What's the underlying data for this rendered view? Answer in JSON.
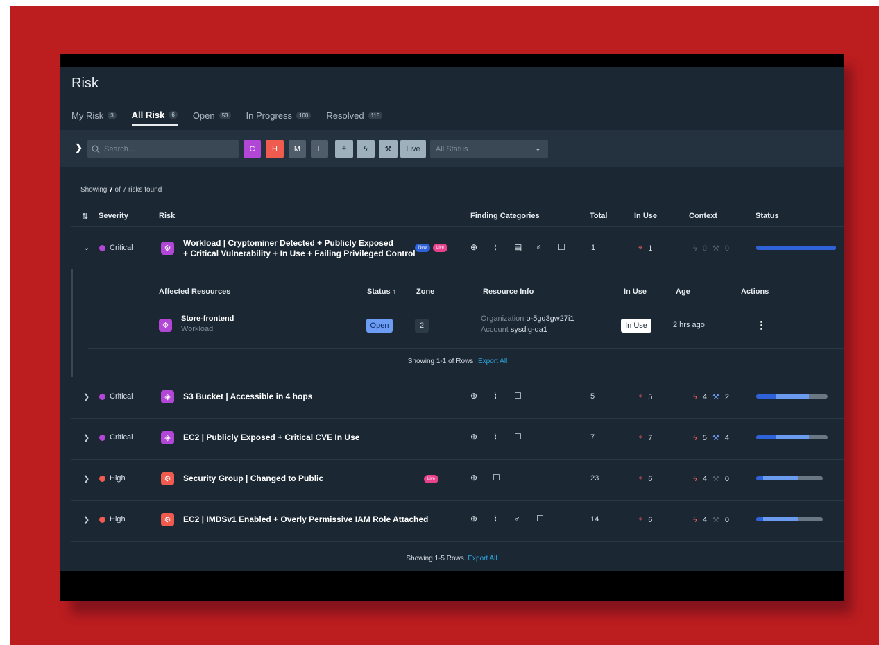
{
  "page": {
    "title": "Risk"
  },
  "tabs": [
    {
      "label": "My Risk",
      "count": "3"
    },
    {
      "label": "All Risk",
      "count": "6"
    },
    {
      "label": "Open",
      "count": "53"
    },
    {
      "label": "In Progress",
      "count": "100"
    },
    {
      "label": "Resolved",
      "count": "115"
    }
  ],
  "toolbar": {
    "search_placeholder": "Search...",
    "severity_chips": [
      "C",
      "H",
      "M",
      "L"
    ],
    "live_label": "Live",
    "status_select": "All Status"
  },
  "summary": {
    "prefix": "Showing",
    "shown": "7",
    "suffix": "of 7 risks found"
  },
  "columns": {
    "severity": "Severity",
    "risk": "Risk",
    "finding_categories": "Finding Categories",
    "total": "Total",
    "in_use": "In Use",
    "context": "Context",
    "status": "Status"
  },
  "rows": [
    {
      "severity": "Critical",
      "color": "#b246d6",
      "name_line1": "Workload | Cryptominer Detected + Publicly Exposed",
      "name_line2": "+ Critical Vulnerability + In Use + Failing Privileged Control",
      "badges": [
        "New",
        "Live"
      ],
      "categories": [
        "globe-icon",
        "bug-icon",
        "checklist-icon",
        "user-icon",
        "chat-icon"
      ],
      "total": "1",
      "in_use": "1",
      "context_events": "0",
      "context_fixes": "0",
      "progress": 1.0
    },
    {
      "severity": "Critical",
      "color": "#b246d6",
      "name_line1": "S3 Bucket | Accessible in 4 hops",
      "badges": [],
      "categories": [
        "globe-icon",
        "bug-icon",
        "chat-icon"
      ],
      "total": "5",
      "in_use": "5",
      "context_events": "4",
      "context_fixes": "2",
      "progress": 0.74
    },
    {
      "severity": "Critical",
      "color": "#b246d6",
      "name_line1": "EC2 | Publicly Exposed + Critical CVE In Use",
      "badges": [],
      "categories": [
        "globe-icon",
        "bug-icon",
        "chat-icon"
      ],
      "total": "7",
      "in_use": "7",
      "context_events": "5",
      "context_fixes": "4",
      "progress": 0.74
    },
    {
      "severity": "High",
      "color": "#ef5b4f",
      "name_line1": "Security Group | Changed to Public",
      "badges": [
        "Live"
      ],
      "categories": [
        "globe-icon",
        "chat-icon"
      ],
      "total": "23",
      "in_use": "6",
      "context_events": "4",
      "context_fixes": "0",
      "progress": 0.63
    },
    {
      "severity": "High",
      "color": "#ef5b4f",
      "name_line1": "EC2 | IMDSv1 Enabled + Overly Permissive IAM Role Attached",
      "badges": [],
      "categories": [
        "globe-icon",
        "bug-icon",
        "user-icon",
        "chat-icon"
      ],
      "total": "14",
      "in_use": "6",
      "context_events": "4",
      "context_fixes": "0",
      "progress": 0.63
    }
  ],
  "expanded": {
    "headers": {
      "affected": "Affected Resources",
      "status": "Status",
      "zone": "Zone",
      "resource_info": "Resource Info",
      "in_use": "In Use",
      "age": "Age",
      "actions": "Actions"
    },
    "resource": {
      "name": "Store-frontend",
      "type": "Workload",
      "status": "Open",
      "zone": "2",
      "org_label": "Organization",
      "org_value": "o-5gq3gw27i1",
      "account_label": "Account",
      "account_value": "sysdig-qa1",
      "in_use": "In Use",
      "age": "2 hrs ago"
    },
    "footer_text": "Showing 1-1 of Rows",
    "footer_link": "Export All"
  },
  "footer": {
    "text": "Showing 1-5 Rows.",
    "link": "Export All"
  },
  "colors": {
    "critical": "#b246d6",
    "high": "#ef5b4f",
    "status_fill": "#2f62d8",
    "status_mid": "#6b9bef",
    "link": "#2ea7e0"
  }
}
